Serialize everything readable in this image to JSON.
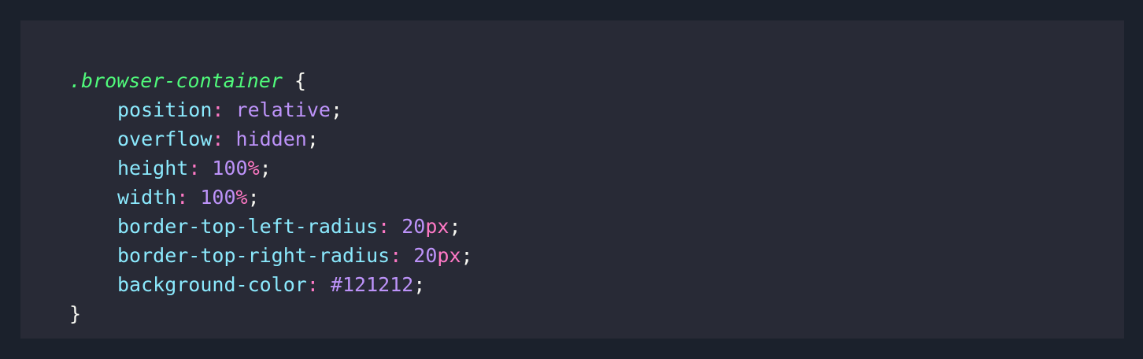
{
  "code": {
    "selector": ".browser-container",
    "open_brace": " {",
    "close_brace": "}",
    "colon": ": ",
    "semicolon": ";",
    "declarations": [
      {
        "property": "position",
        "value": "relative",
        "unit": ""
      },
      {
        "property": "overflow",
        "value": "hidden",
        "unit": ""
      },
      {
        "property": "height",
        "value": "100",
        "unit": "%"
      },
      {
        "property": "width",
        "value": "100",
        "unit": "%"
      },
      {
        "property": "border-top-left-radius",
        "value": "20",
        "unit": "px"
      },
      {
        "property": "border-top-right-radius",
        "value": "20",
        "unit": "px"
      },
      {
        "property": "background-color",
        "value": "#121212",
        "unit": ""
      }
    ]
  },
  "colors": {
    "page_background": "#1b212c",
    "code_background": "#282a36",
    "selector": "#50fa7b",
    "property": "#8be9fd",
    "value": "#bd93f9",
    "punctuation": "#ff79c6",
    "text": "#f8f8f2"
  }
}
